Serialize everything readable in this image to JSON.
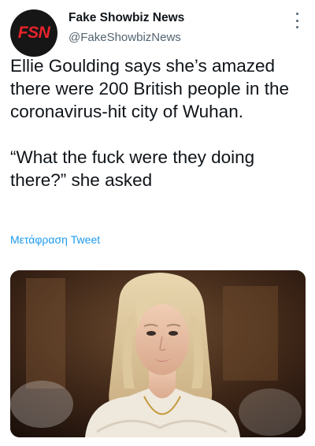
{
  "account": {
    "avatar_text": "FSN",
    "display_name": "Fake Showbiz News",
    "handle": "@FakeShowbizNews"
  },
  "tweet": {
    "text": "Ellie Goulding says she’s amazed there were 200 British people in the coronavirus-hit city of Wuhan.\n\n“What the fuck were they doing there?” she asked",
    "translate_label": "Μετάφραση Tweet"
  },
  "colors": {
    "accent": "#1d9bf0",
    "avatar_bg": "#161616",
    "avatar_text": "#e8232b"
  },
  "icons": {
    "more": "more-vertical-icon"
  }
}
